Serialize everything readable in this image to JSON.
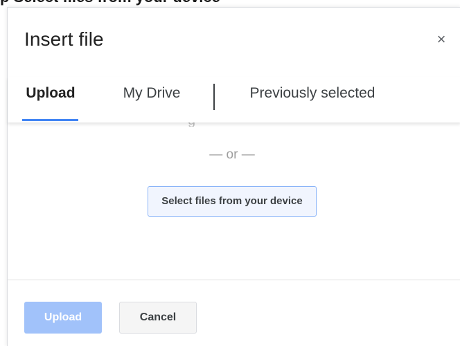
{
  "top_strip": {
    "text": "p Select files from your device"
  },
  "dialog": {
    "title": "Insert file",
    "close_glyph": "×"
  },
  "tabs": [
    {
      "label": "Upload",
      "active": true
    },
    {
      "label": "My Drive",
      "active": false
    },
    {
      "label": "Previously selected",
      "active": false
    }
  ],
  "content": {
    "drag_remnant": "g",
    "or_text": "— or —",
    "select_button_label": "Select files from your device"
  },
  "footer": {
    "upload_label": "Upload",
    "cancel_label": "Cancel"
  },
  "colors": {
    "accent": "#4285f4",
    "upload_disabled": "#a1c2fa",
    "select_button_bg": "#f1f5fe",
    "select_button_border": "#8ab4f8"
  },
  "icons": {
    "close": "close-icon"
  }
}
